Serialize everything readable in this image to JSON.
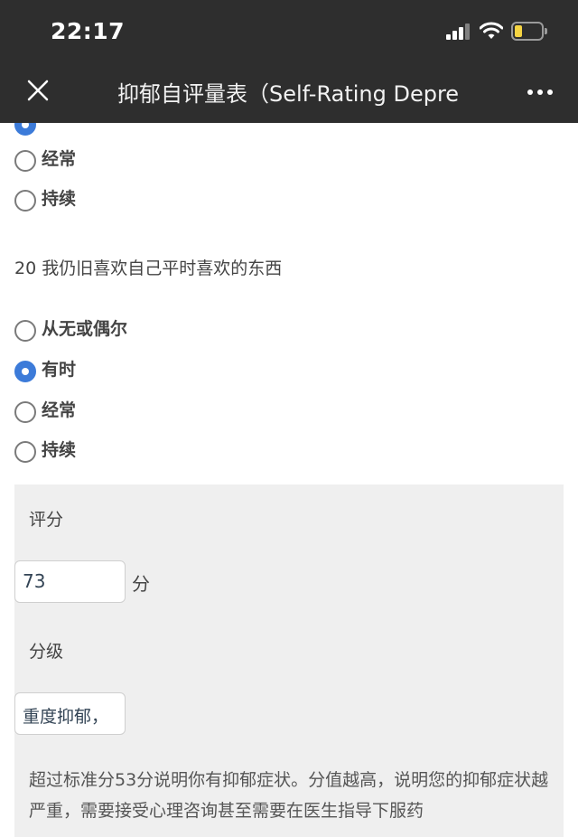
{
  "status_bar": {
    "time": "22:17"
  },
  "nav": {
    "title": "抑郁自评量表（Self-Rating Depre",
    "close_icon": "close-icon",
    "more_icon": "more-horizontal-icon"
  },
  "prev_question": {
    "options": [
      {
        "label": "经常",
        "checked": false
      },
      {
        "label": "持续",
        "checked": false
      }
    ]
  },
  "question20": {
    "text": "20 我仍旧喜欢自己平时喜欢的东西",
    "options": [
      {
        "label": "从无或偶尔",
        "checked": false
      },
      {
        "label": "有时",
        "checked": true
      },
      {
        "label": "经常",
        "checked": false
      },
      {
        "label": "持续",
        "checked": false
      }
    ]
  },
  "result": {
    "score_label": "评分",
    "score_value": "73",
    "score_unit": "分",
    "grade_label": "分级",
    "grade_value": "重度抑郁，",
    "note": "超过标准分53分说明你有抑郁症状。分值越高，说明您的抑郁症状越严重，需要接受心理咨询甚至需要在医生指导下服药"
  },
  "colors": {
    "accent": "#3c7bd9",
    "topbar": "#2e2e2e",
    "panel": "#efefef"
  }
}
